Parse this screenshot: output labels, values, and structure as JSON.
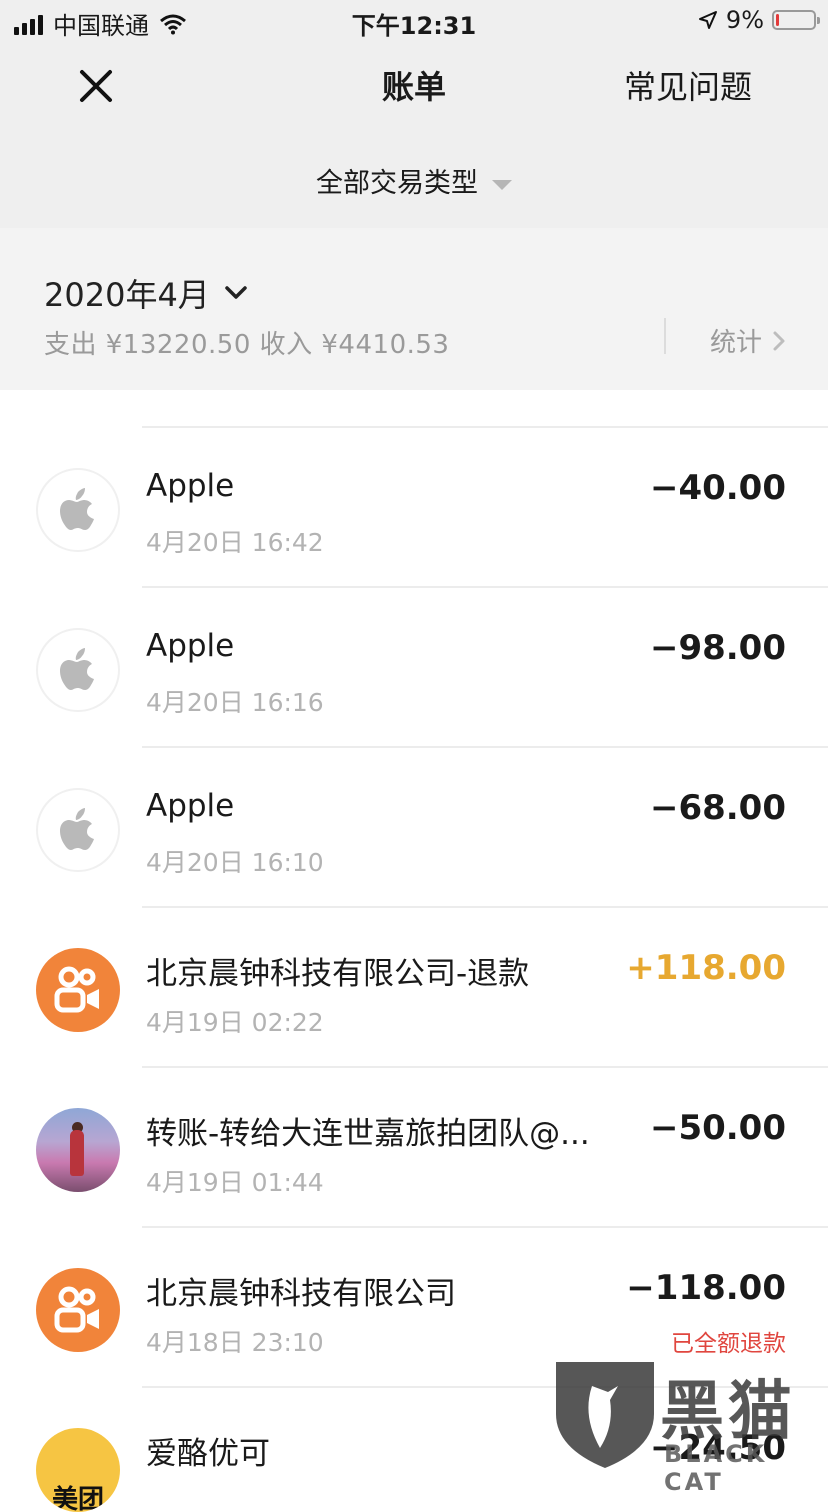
{
  "status_bar": {
    "carrier": "中国联通",
    "time": "下午12:31",
    "battery_percent": "9%",
    "battery_level": 0.09,
    "signal_bars": 4
  },
  "nav": {
    "title": "账单",
    "faq_label": "常见问题"
  },
  "filter": {
    "label": "全部交易类型"
  },
  "month": {
    "label": "2020年4月",
    "summary": "支出 ¥13220.50 收入 ¥4410.53",
    "stats_label": "统计"
  },
  "transactions": [
    {
      "name": "Apple",
      "time": "4月20日 16:42",
      "amount": "−40.00",
      "type": "expense",
      "avatar": "apple-icon"
    },
    {
      "name": "Apple",
      "time": "4月20日 16:16",
      "amount": "−98.00",
      "type": "expense",
      "avatar": "apple-icon"
    },
    {
      "name": "Apple",
      "time": "4月20日 16:10",
      "amount": "−68.00",
      "type": "expense",
      "avatar": "apple-icon"
    },
    {
      "name": "北京晨钟科技有限公司-退款",
      "time": "4月19日 02:22",
      "amount": "+118.00",
      "type": "income",
      "avatar": "kuaishou-logo-icon"
    },
    {
      "name": "转账-转给大连世嘉旅拍团队@...",
      "time": "4月19日 01:44",
      "amount": "−50.00",
      "type": "expense",
      "avatar": "user-photo-avatar"
    },
    {
      "name": "北京晨钟科技有限公司",
      "time": "4月18日 23:10",
      "amount": "−118.00",
      "type": "expense",
      "avatar": "kuaishou-logo-icon",
      "note": "已全额退款"
    },
    {
      "name": "爱酪优可",
      "time": "",
      "amount": "−24.50",
      "type": "expense",
      "avatar": "meituan-logo-icon",
      "avatar_text": "美团"
    }
  ],
  "watermark": {
    "text": "黑猫",
    "sub": "BLACK CAT"
  },
  "colors": {
    "income": "#e7a830",
    "refund_note": "#e0463f",
    "kuaishou_orange": "#f1843a",
    "meituan_yellow": "#f6c543"
  }
}
